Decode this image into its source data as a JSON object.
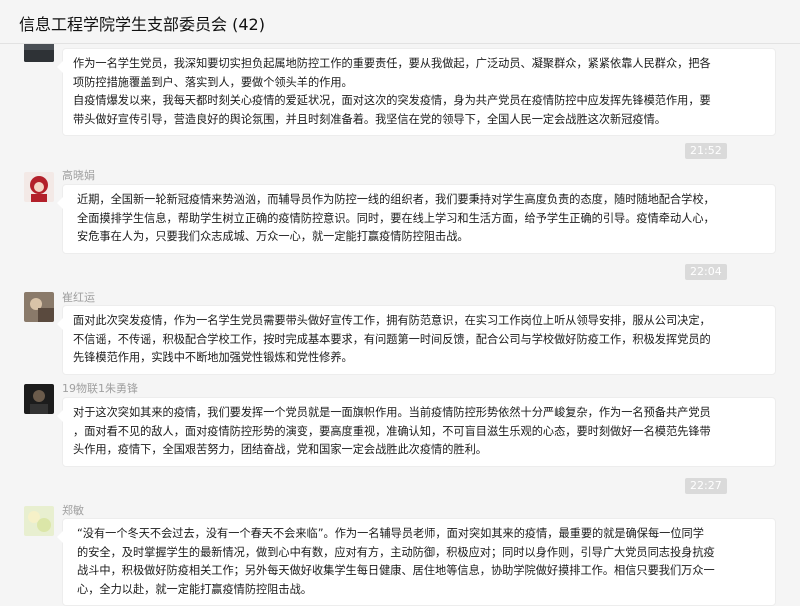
{
  "window": {
    "title": "信息工程学院学生支部委员会 (42)"
  },
  "messages": [
    {
      "sender": "",
      "lines": [
        "作为一名学生党员，我深知要切实担负起属地防控工作的重要责任，要从我做起，广泛动员、凝聚群众，紧紧依靠人民群众，把各",
        "项防控措施覆盖到户、落实到人，要做个领头羊的作用。",
        "自疫情爆发以来，我每天都时刻关心疫情的爱延状况，面对这次的突发疫情，身为共产党员在疫情防控中应发挥先锋模范作用，要",
        "带头做好宣传引导，营造良好的舆论氛围，并且时刻准备着。我坚信在党的领导下，全国人民一定会战胜这次新冠疫情。"
      ]
    },
    {
      "time": "21:52",
      "sender": "高晓娟",
      "lines": [
        "近期，全国新一轮新冠疫情来势汹汹，而辅导员作为防控一线的组织者，我们要秉持对学生高度负责的态度，随时随地配合学校，",
        "全面摸排学生信息，帮助学生树立正确的疫情防控意识。同时，要在线上学习和生活方面，给予学生正确的引导。疫情牵动人心，",
        "安危事在人为，只要我们众志成城、万众一心，就一定能打赢疫情防控阻击战。"
      ]
    },
    {
      "time": "22:04",
      "sender": "崔红运",
      "lines": [
        "面对此次突发疫情，作为一名学生党员需要带头做好宣传工作，拥有防范意识，在实习工作岗位上听从领导安排，服从公司决定，",
        "不信谣，不传谣，积极配合学校工作，按时完成基本要求，有问题第一时间反馈，配合公司与学校做好防疫工作，积极发挥党员的",
        "先锋模范作用，实践中不断地加强党性锻炼和党性修养。"
      ]
    },
    {
      "sender": "19物联1朱勇锋",
      "lines": [
        "对于这次突如其来的疫情，我们要发挥一个党员就是一面旗帜作用。当前疫情防控形势依然十分严峻复杂，作为一名预备共产党员",
        "，面对看不见的敌人，面对疫情防控形势的演变，要高度重视，准确认知，不可盲目滋生乐观的心态，要时刻做好一名模范先锋带",
        "头作用，疫情下，全国艰苦努力，团结奋战，党和国家一定会战胜此次疫情的胜利。"
      ]
    },
    {
      "time": "22:27",
      "sender": "郑敏",
      "lines": [
        "“没有一个冬天不会过去，没有一个春天不会来临”。作为一名辅导员老师，面对突如其来的疫情，最重要的就是确保每一位同学",
        "的安全，及时掌握学生的最新情况，做到心中有数，应对有方，主动防御，积极应对；同时以身作则，引导广大党员同志投身抗疫",
        "战斗中，积极做好防疫相关工作；另外每天做好收集学生每日健康、居住地等信息，协助学院做好摸排工作。相信只要我们万众一",
        "心，全力以赴，就一定能打赢疫情防控阻击战。"
      ]
    }
  ]
}
